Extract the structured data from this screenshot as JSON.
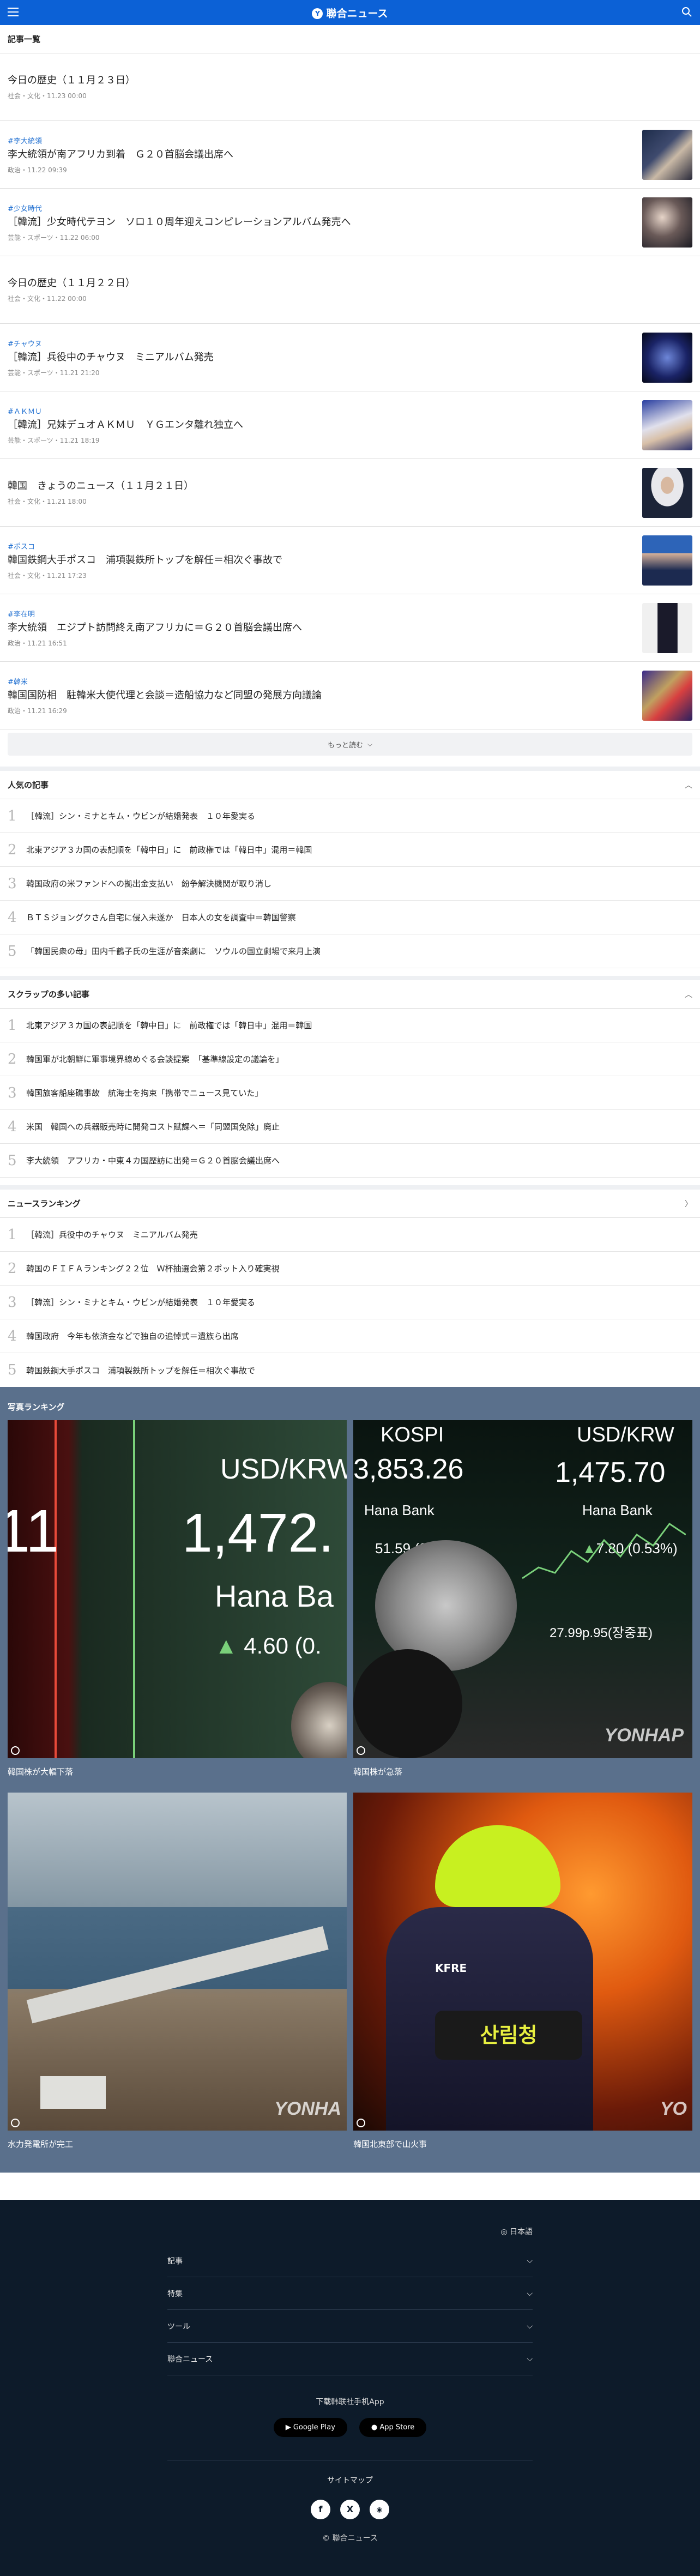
{
  "header": {
    "logo_text": "聯合ニュース",
    "logo_mark": "Y",
    "menu_icon": "hamburger-icon",
    "search_icon": "search-icon",
    "brand_color": "#0c61d6"
  },
  "list_title": "記事一覧",
  "articles": [
    {
      "tag": "",
      "title": "今日の歴史（１１月２３日）",
      "meta": "社会・文化・11.23 00:00",
      "thumb": false
    },
    {
      "tag": "#李大統領",
      "title": "李大統領が南アフリカ到着　Ｇ２０首脳会議出席へ",
      "meta": "政治・11.22 09:39",
      "thumb": true
    },
    {
      "tag": "#少女時代",
      "title": "［韓流］少女時代テヨン　ソロ１０周年迎えコンピレーションアルバム発売へ",
      "meta": "芸能・スポーツ・11.22 06:00",
      "thumb": true
    },
    {
      "tag": "",
      "title": "今日の歴史（１１月２２日）",
      "meta": "社会・文化・11.22 00:00",
      "thumb": false
    },
    {
      "tag": "#チャウヌ",
      "title": "［韓流］兵役中のチャウヌ　ミニアルバム発売",
      "meta": "芸能・スポーツ・11.21 21:20",
      "thumb": true
    },
    {
      "tag": "#ＡＫＭＵ",
      "title": "［韓流］兄妹デュオＡＫＭＵ　ＹＧエンタ離れ独立へ",
      "meta": "芸能・スポーツ・11.21 18:19",
      "thumb": true
    },
    {
      "tag": "",
      "title": "韓国　きょうのニュース（１１月２１日）",
      "meta": "社会・文化・11.21 18:00",
      "thumb": true
    },
    {
      "tag": "#ポスコ",
      "title": "韓国鉄鋼大手ポスコ　浦項製鉄所トップを解任＝相次ぐ事故で",
      "meta": "社会・文化・11.21 17:23",
      "thumb": true
    },
    {
      "tag": "#李在明",
      "title": "李大統領　エジプト訪問終え南アフリカに＝Ｇ２０首脳会議出席へ",
      "meta": "政治・11.21 16:51",
      "thumb": true
    },
    {
      "tag": "#韓米",
      "title": "韓国国防相　駐韓米大使代理と会談＝造船協力など同盟の発展方向議論",
      "meta": "政治・11.21 16:29",
      "thumb": true
    }
  ],
  "more_label": "もっと読む",
  "popular": {
    "title": "人気の記事",
    "items": [
      {
        "num": "1",
        "title": "［韓流］シン・ミナとキム・ウビンが結婚発表　１０年愛実る"
      },
      {
        "num": "2",
        "title": "北東アジア３カ国の表記順を「韓中日」に　前政権では「韓日中」混用＝韓国"
      },
      {
        "num": "3",
        "title": "韓国政府の米ファンドへの拠出金支払い　紛争解決機関が取り消し"
      },
      {
        "num": "4",
        "title": "ＢＴＳジョングクさん自宅に侵入未遂か　日本人の女を調査中＝韓国警察"
      },
      {
        "num": "5",
        "title": "「韓国民衆の母」田内千鶴子氏の生涯が音楽劇に　ソウルの国立劇場で来月上演"
      }
    ]
  },
  "scrap": {
    "title": "スクラップの多い記事",
    "items": [
      {
        "num": "1",
        "title": "北東アジア３カ国の表記順を「韓中日」に　前政権では「韓日中」混用＝韓国"
      },
      {
        "num": "2",
        "title": "韓国軍が北朝鮮に軍事境界線めぐる会談提案　「基準線設定の議論を」"
      },
      {
        "num": "3",
        "title": "韓国旅客船座礁事故　航海士を拘束「携帯でニュース見ていた」"
      },
      {
        "num": "4",
        "title": "米国　韓国への兵器販売時に開発コスト賦課へ＝「同盟国免除」廃止"
      },
      {
        "num": "5",
        "title": "李大統領　アフリカ・中東４カ国歴訪に出発＝Ｇ２０首脳会議出席へ"
      }
    ]
  },
  "ranking": {
    "title": "ニュースランキング",
    "items": [
      {
        "num": "1",
        "title": "［韓流］兵役中のチャウヌ　ミニアルバム発売"
      },
      {
        "num": "2",
        "title": "韓国のＦＩＦＡランキング２２位　Ｗ杯抽選会第２ポット入り確実視"
      },
      {
        "num": "3",
        "title": "［韓流］シン・ミナとキム・ウビンが結婚発表　１０年愛実る"
      },
      {
        "num": "4",
        "title": "韓国政府　今年も依済金などで独自の追悼式＝遺族ら出席"
      },
      {
        "num": "5",
        "title": "韓国鉄鋼大手ポスコ　浦項製鉄所トップを解任＝相次ぐ事故で"
      }
    ]
  },
  "photos": {
    "title": "写真ランキング",
    "items": [
      {
        "caption": "韓国株が大幅下落",
        "screen_top": "USD/KRW",
        "screen_value": "1,472.",
        "screen_bank": "Hana Ba",
        "screen_sub": "4.60 (0."
      },
      {
        "caption": "韓国株が急落",
        "screen_top": "KOSPI",
        "screen_value": "3,853.26",
        "screen_bank": "Hana Bank",
        "screen_sub": "51.59 (3.79%)",
        "screen_top2": "USD/KRW",
        "screen_value2": "1,475.70",
        "screen_bank2": "Hana Bank",
        "screen_sub2": "7.80 (0.53%)",
        "screen_bottom": "27.99p.95(장중표)",
        "watermark": "YONHAP"
      },
      {
        "caption": "水力発電所が完工",
        "watermark": "YONHA"
      },
      {
        "caption": "韓国北東部で山火事",
        "vest": "KFRE",
        "badge": "산림청",
        "watermark": "YO"
      }
    ]
  },
  "footer": {
    "lang": "日本語",
    "menu": [
      "記事",
      "特集",
      "ツール",
      "聯合ニュース"
    ],
    "download": "下载韩联社手机App",
    "google_play": "Google Play",
    "app_store": "App Store",
    "sitemap": "サイトマップ",
    "social": [
      "f",
      "X",
      "rss"
    ],
    "copyright": "© 聯合ニュース"
  }
}
